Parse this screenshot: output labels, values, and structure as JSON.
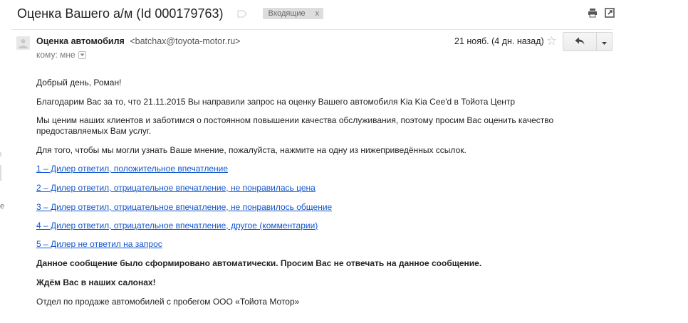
{
  "subject": "Оценка Вашего а/м (Id 000179763)",
  "label": {
    "text": "Входящие",
    "close": "x"
  },
  "sender": {
    "name": "Оценка автомобиля",
    "email": "<batchax@toyota-motor.ru>",
    "to_line": "кому: мне"
  },
  "date": "21 нояб. (4 дн. назад)",
  "body": {
    "greeting": "Добрый день, Роман!",
    "para1": "Благодарим Вас за то, что 21.11.2015 Вы направили запрос на оценку Вашего автомобиля Kia Kia Cee'd в Тойота Центр",
    "para2": "Мы ценим наших клиентов и заботимся о постоянном повышении качества обслуживания, поэтому просим Вас оценить качество предоставляемых Вам услуг.",
    "para3": "Для того, чтобы мы могли узнать Ваше мнение, пожалуйста, нажмите на одну из нижеприведённых ссылок.",
    "links": [
      "1 – Дилер ответил, положительное впечатление",
      "2 – Дилер ответил, отрицательное впечатление, не понравилась цена",
      "3 – Дилер ответил, отрицательное впечатление, не понравилось общение",
      "4 – Дилер ответил, отрицательное впечатление, другое (комментарии)",
      "5 – Дилер не ответил на запрос"
    ],
    "auto_notice": "Данное сообщение было сформировано автоматически.  Просим Вас не отвечать на данное сообщение.",
    "closing": "Ждём Вас в наших салонах!",
    "signature": "Отдел по продаже автомобилей с пробегом ООО «Тойота Мотор»"
  },
  "edge_char": "e",
  "icons": {
    "print": "print-icon",
    "new_window": "new-window-icon",
    "important": "importance-marker-icon",
    "star": "star-icon",
    "reply": "reply-icon",
    "more": "dropdown-arrow-icon",
    "avatar": "contact-avatar-icon"
  },
  "colors": {
    "link": "#1155cc",
    "label_bg": "#dddddd"
  }
}
